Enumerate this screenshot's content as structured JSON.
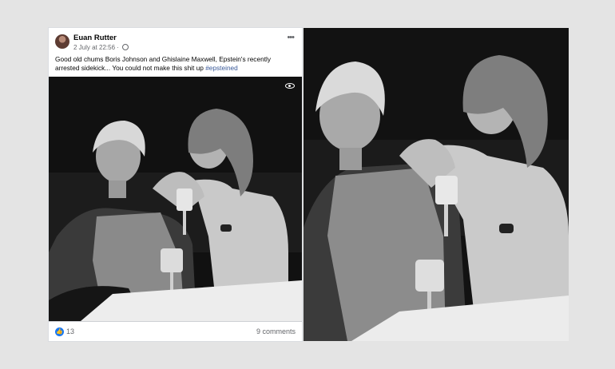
{
  "post": {
    "author": "Euan Rutter",
    "timestamp": "2 July at 22:56 ·",
    "privacy_icon": "globe-icon",
    "more_icon": "more-options-icon",
    "text": "Good old chums Boris Johnson and Ghislaine Maxwell, Epstein's recently arrested sidekick... You could not make this shit up",
    "hashtag": "#epsteined",
    "photo_icon": "eye-icon",
    "reaction_icon": "like-icon",
    "reactions": "13",
    "comments": "9 comments"
  }
}
